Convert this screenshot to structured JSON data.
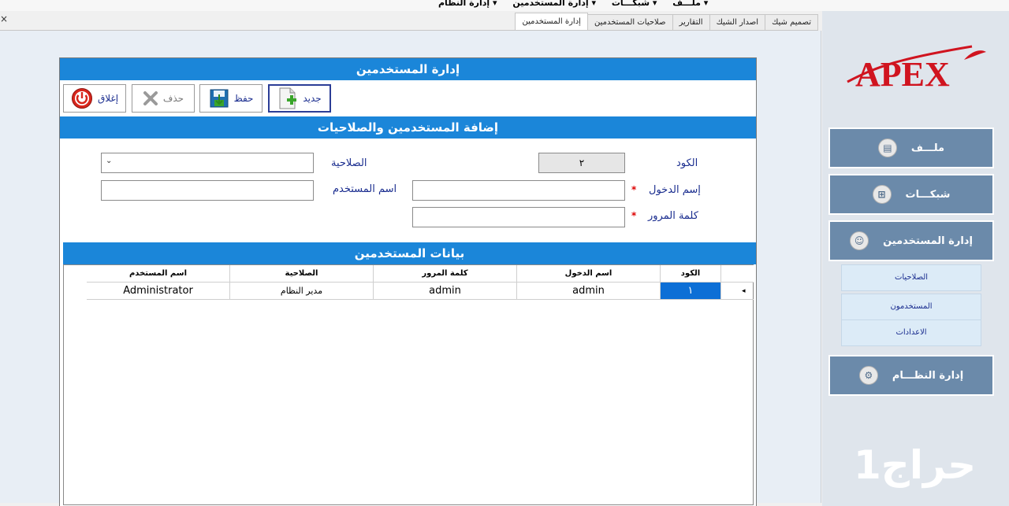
{
  "top_menu": {
    "items": [
      "ملـــف",
      "شبكـــات",
      "إدارة المستخدمين",
      "إدارة النظام"
    ],
    "close": "×"
  },
  "tabs": [
    "تصميم شيك",
    "اصدار الشيك",
    "التقارير",
    "صلاحيات المستخدمين",
    "إدارة المستخدمين"
  ],
  "active_tab": "إدارة المستخدمين",
  "panel": {
    "title": "إدارة المستخدمين",
    "toolbar": {
      "new_label": "جديد",
      "save_label": "حفظ",
      "delete_label": "حذف",
      "close_label": "إغلاق"
    },
    "subtitle": "إضافة المستخدمين والصلاحيات",
    "form": {
      "code_label": "الكود",
      "code_value": "٢",
      "login_label": "إسم الدخول",
      "password_label": "كلمة المرور",
      "permission_label": "الصلاحية",
      "username_label": "اسم المستخدم",
      "required_mark": "*"
    },
    "data_title": "بيانات المستخدمين",
    "grid": {
      "headers": [
        "الكود",
        "اسم الدخول",
        "كلمة المرور",
        "الصلاحية",
        "اسم المستخدم"
      ],
      "rows": [
        [
          "١",
          "admin",
          "admin",
          "مدير النظام",
          "Administrator"
        ]
      ],
      "row_indicator": "◂"
    }
  },
  "sidebar": {
    "logo_text": "APEX",
    "nav": [
      {
        "label": "ملـــف",
        "icon": "file-icon"
      },
      {
        "label": "شبكـــات",
        "icon": "network-icon"
      },
      {
        "label": "إدارة المستخدمين",
        "icon": "users-icon"
      },
      {
        "label": "إدارة النظـــام",
        "icon": "system-icon"
      }
    ],
    "sub_items": [
      "الصلاحيات",
      "المستخدمون",
      "الاعدادات"
    ],
    "watermark": "حراج1"
  },
  "colors": {
    "blue_bar": "#1b86d9",
    "nav_button": "#6b8aaa",
    "selected_cell": "#0d6fd6",
    "logo_red": "#d0141f"
  }
}
